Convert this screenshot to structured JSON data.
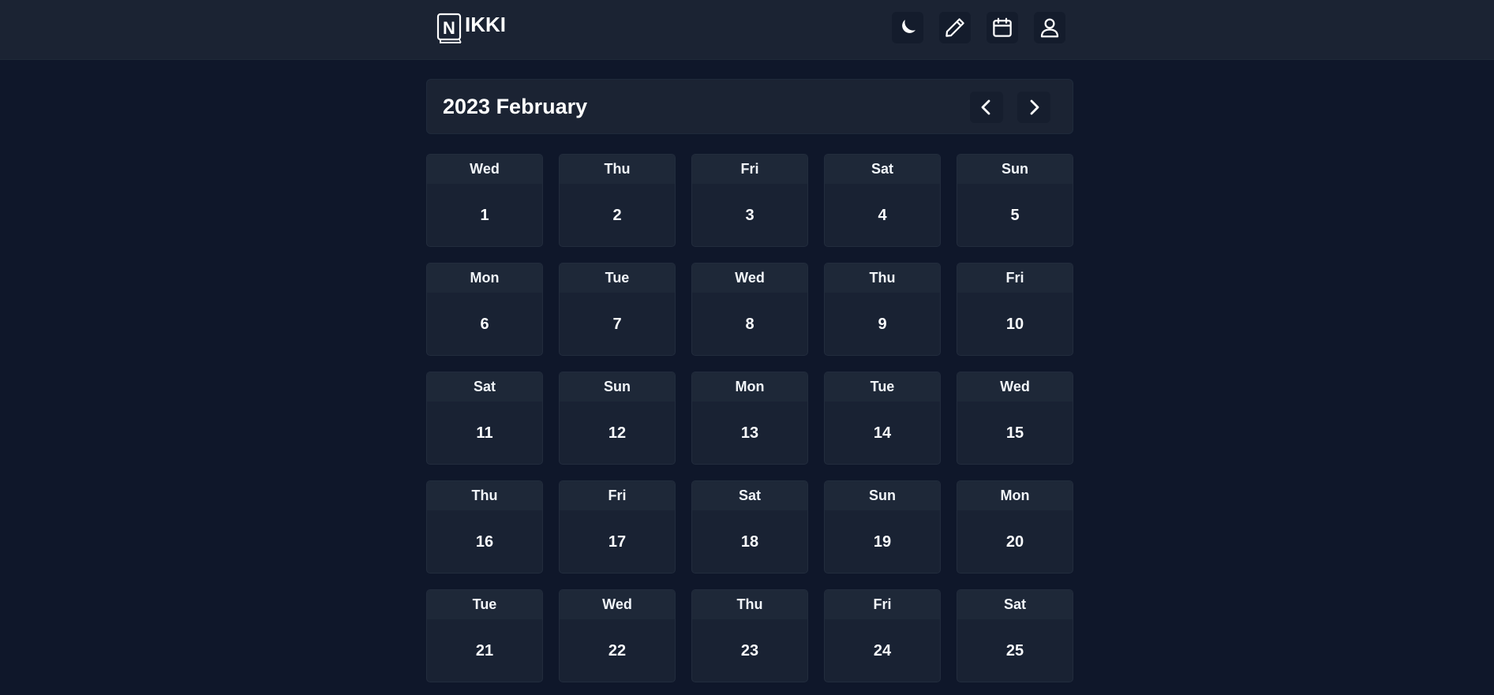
{
  "app": {
    "logo_letter": "N",
    "logo_text": "IKKI"
  },
  "nav": {
    "icons": [
      "moon-icon",
      "pencil-icon",
      "calendar-icon",
      "user-icon"
    ]
  },
  "calendar": {
    "title": "2023 February",
    "days": [
      {
        "name": "Wed",
        "num": "1"
      },
      {
        "name": "Thu",
        "num": "2"
      },
      {
        "name": "Fri",
        "num": "3"
      },
      {
        "name": "Sat",
        "num": "4"
      },
      {
        "name": "Sun",
        "num": "5"
      },
      {
        "name": "Mon",
        "num": "6"
      },
      {
        "name": "Tue",
        "num": "7"
      },
      {
        "name": "Wed",
        "num": "8"
      },
      {
        "name": "Thu",
        "num": "9"
      },
      {
        "name": "Fri",
        "num": "10"
      },
      {
        "name": "Sat",
        "num": "11"
      },
      {
        "name": "Sun",
        "num": "12"
      },
      {
        "name": "Mon",
        "num": "13"
      },
      {
        "name": "Tue",
        "num": "14"
      },
      {
        "name": "Wed",
        "num": "15"
      },
      {
        "name": "Thu",
        "num": "16"
      },
      {
        "name": "Fri",
        "num": "17"
      },
      {
        "name": "Sat",
        "num": "18"
      },
      {
        "name": "Sun",
        "num": "19"
      },
      {
        "name": "Mon",
        "num": "20"
      },
      {
        "name": "Tue",
        "num": "21"
      },
      {
        "name": "Wed",
        "num": "22"
      },
      {
        "name": "Thu",
        "num": "23"
      },
      {
        "name": "Fri",
        "num": "24"
      },
      {
        "name": "Sat",
        "num": "25"
      }
    ]
  },
  "colors": {
    "background": "#0f172a",
    "topbar": "#1b2333",
    "card": "#192233",
    "card_header": "#1e2838",
    "text": "#f1f5f9"
  }
}
